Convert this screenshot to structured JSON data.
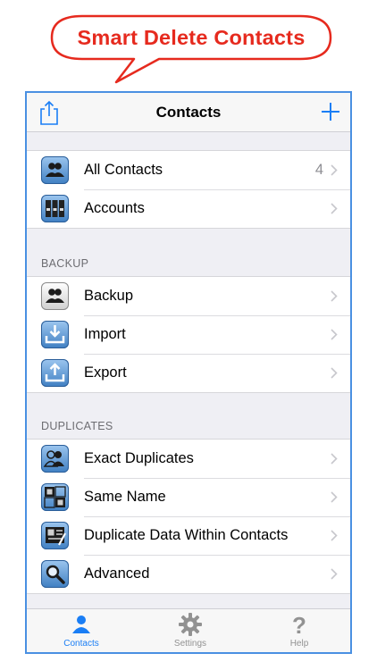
{
  "banner": {
    "text": "Smart Delete Contacts"
  },
  "navbar": {
    "title": "Contacts"
  },
  "groups": {
    "main": [
      {
        "label": "All Contacts",
        "count": "4",
        "icon": "people-icon"
      },
      {
        "label": "Accounts",
        "icon": "accounts-icon"
      }
    ],
    "backup": {
      "header": "BACKUP",
      "items": [
        {
          "label": "Backup",
          "icon": "backup-icon"
        },
        {
          "label": "Import",
          "icon": "import-icon"
        },
        {
          "label": "Export",
          "icon": "export-icon"
        }
      ]
    },
    "duplicates": {
      "header": "DUPLICATES",
      "items": [
        {
          "label": "Exact Duplicates",
          "icon": "exact-duplicates-icon"
        },
        {
          "label": "Same Name",
          "icon": "same-name-icon"
        },
        {
          "label": "Duplicate Data Within Contacts",
          "icon": "duplicate-data-icon"
        },
        {
          "label": "Advanced",
          "icon": "magnifier-icon"
        }
      ]
    }
  },
  "tabbar": {
    "tabs": [
      {
        "label": "Contacts",
        "icon": "person-icon",
        "active": true
      },
      {
        "label": "Settings",
        "icon": "gear-icon",
        "active": false
      },
      {
        "label": "Help",
        "icon": "question-icon",
        "active": false
      }
    ]
  },
  "colors": {
    "accent": "#1a7ef5",
    "banner": "#e62a1e",
    "frame": "#4a90e2"
  }
}
